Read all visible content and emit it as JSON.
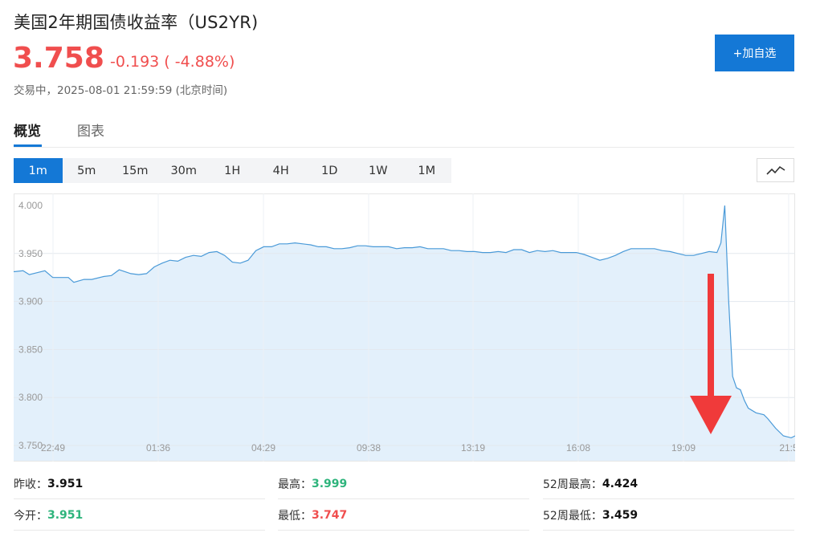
{
  "header": {
    "title": "美国2年期国债收益率（US2YR)",
    "price": "3.758",
    "change": "-0.193 ( -4.88%)",
    "status": "交易中，2025-08-01 21:59:59 (北京时间)",
    "add_button": "+加自选"
  },
  "tabs": [
    {
      "label": "概览",
      "active": true
    },
    {
      "label": "图表",
      "active": false
    }
  ],
  "periods": [
    {
      "label": "1m",
      "active": true
    },
    {
      "label": "5m",
      "active": false
    },
    {
      "label": "15m",
      "active": false
    },
    {
      "label": "30m",
      "active": false
    },
    {
      "label": "1H",
      "active": false
    },
    {
      "label": "4H",
      "active": false
    },
    {
      "label": "1D",
      "active": false
    },
    {
      "label": "1W",
      "active": false
    },
    {
      "label": "1M",
      "active": false
    }
  ],
  "chart_type_icon": "line-chart-icon",
  "annotation": {
    "type": "arrow",
    "direction": "down",
    "color": "#f03a3a"
  },
  "chart_data": {
    "type": "area",
    "ylim": [
      3.75,
      4.01
    ],
    "yticks": [
      "4.000",
      "3.950",
      "3.900",
      "3.850",
      "3.800",
      "3.750"
    ],
    "xticks": [
      "22:49",
      "01:36",
      "04:29",
      "09:38",
      "13:19",
      "16:08",
      "19:09",
      "21:5"
    ],
    "line_color": "#4a9ad8",
    "fill_color": "#e3f0fb",
    "x": [
      0,
      0.012,
      0.02,
      0.03,
      0.04,
      0.05,
      0.055,
      0.07,
      0.077,
      0.09,
      0.1,
      0.115,
      0.125,
      0.135,
      0.15,
      0.16,
      0.17,
      0.18,
      0.19,
      0.2,
      0.21,
      0.22,
      0.23,
      0.24,
      0.25,
      0.26,
      0.27,
      0.28,
      0.29,
      0.3,
      0.31,
      0.32,
      0.33,
      0.34,
      0.35,
      0.36,
      0.37,
      0.38,
      0.39,
      0.4,
      0.41,
      0.42,
      0.43,
      0.44,
      0.45,
      0.46,
      0.47,
      0.48,
      0.49,
      0.5,
      0.51,
      0.52,
      0.53,
      0.54,
      0.55,
      0.56,
      0.57,
      0.58,
      0.59,
      0.6,
      0.61,
      0.62,
      0.63,
      0.64,
      0.65,
      0.66,
      0.67,
      0.68,
      0.69,
      0.7,
      0.71,
      0.72,
      0.73,
      0.74,
      0.75,
      0.76,
      0.77,
      0.78,
      0.79,
      0.8,
      0.81,
      0.82,
      0.83,
      0.84,
      0.85,
      0.86,
      0.87,
      0.88,
      0.89,
      0.9,
      0.905,
      0.91,
      0.915,
      0.92,
      0.925,
      0.93,
      0.935,
      0.94,
      0.95,
      0.96,
      0.965,
      0.975,
      0.985,
      0.995,
      1.0
    ],
    "values": [
      3.931,
      3.932,
      3.928,
      3.93,
      3.932,
      3.925,
      3.925,
      3.925,
      3.92,
      3.923,
      3.923,
      3.926,
      3.927,
      3.933,
      3.929,
      3.928,
      3.929,
      3.936,
      3.94,
      3.943,
      3.942,
      3.946,
      3.948,
      3.947,
      3.951,
      3.952,
      3.948,
      3.941,
      3.94,
      3.943,
      3.953,
      3.957,
      3.957,
      3.96,
      3.96,
      3.961,
      3.96,
      3.959,
      3.957,
      3.957,
      3.955,
      3.955,
      3.956,
      3.958,
      3.958,
      3.957,
      3.957,
      3.957,
      3.955,
      3.956,
      3.956,
      3.957,
      3.955,
      3.955,
      3.955,
      3.953,
      3.953,
      3.952,
      3.952,
      3.951,
      3.951,
      3.952,
      3.951,
      3.954,
      3.954,
      3.951,
      3.953,
      3.952,
      3.953,
      3.951,
      3.951,
      3.951,
      3.949,
      3.946,
      3.943,
      3.945,
      3.948,
      3.952,
      3.955,
      3.955,
      3.955,
      3.955,
      3.953,
      3.952,
      3.95,
      3.948,
      3.948,
      3.95,
      3.952,
      3.951,
      3.961,
      4.0,
      3.9,
      3.822,
      3.81,
      3.808,
      3.797,
      3.789,
      3.784,
      3.782,
      3.778,
      3.768,
      3.76,
      3.758,
      3.76
    ]
  },
  "stats": [
    {
      "label": "昨收：",
      "value": "3.951",
      "tone": "neutral"
    },
    {
      "label": "最高：",
      "value": "3.999",
      "tone": "up"
    },
    {
      "label": "52周最高：",
      "value": "4.424",
      "tone": "neutral"
    },
    {
      "label": "今开：",
      "value": "3.951",
      "tone": "up"
    },
    {
      "label": "最低：",
      "value": "3.747",
      "tone": "down"
    },
    {
      "label": "52周最低：",
      "value": "3.459",
      "tone": "neutral"
    }
  ]
}
